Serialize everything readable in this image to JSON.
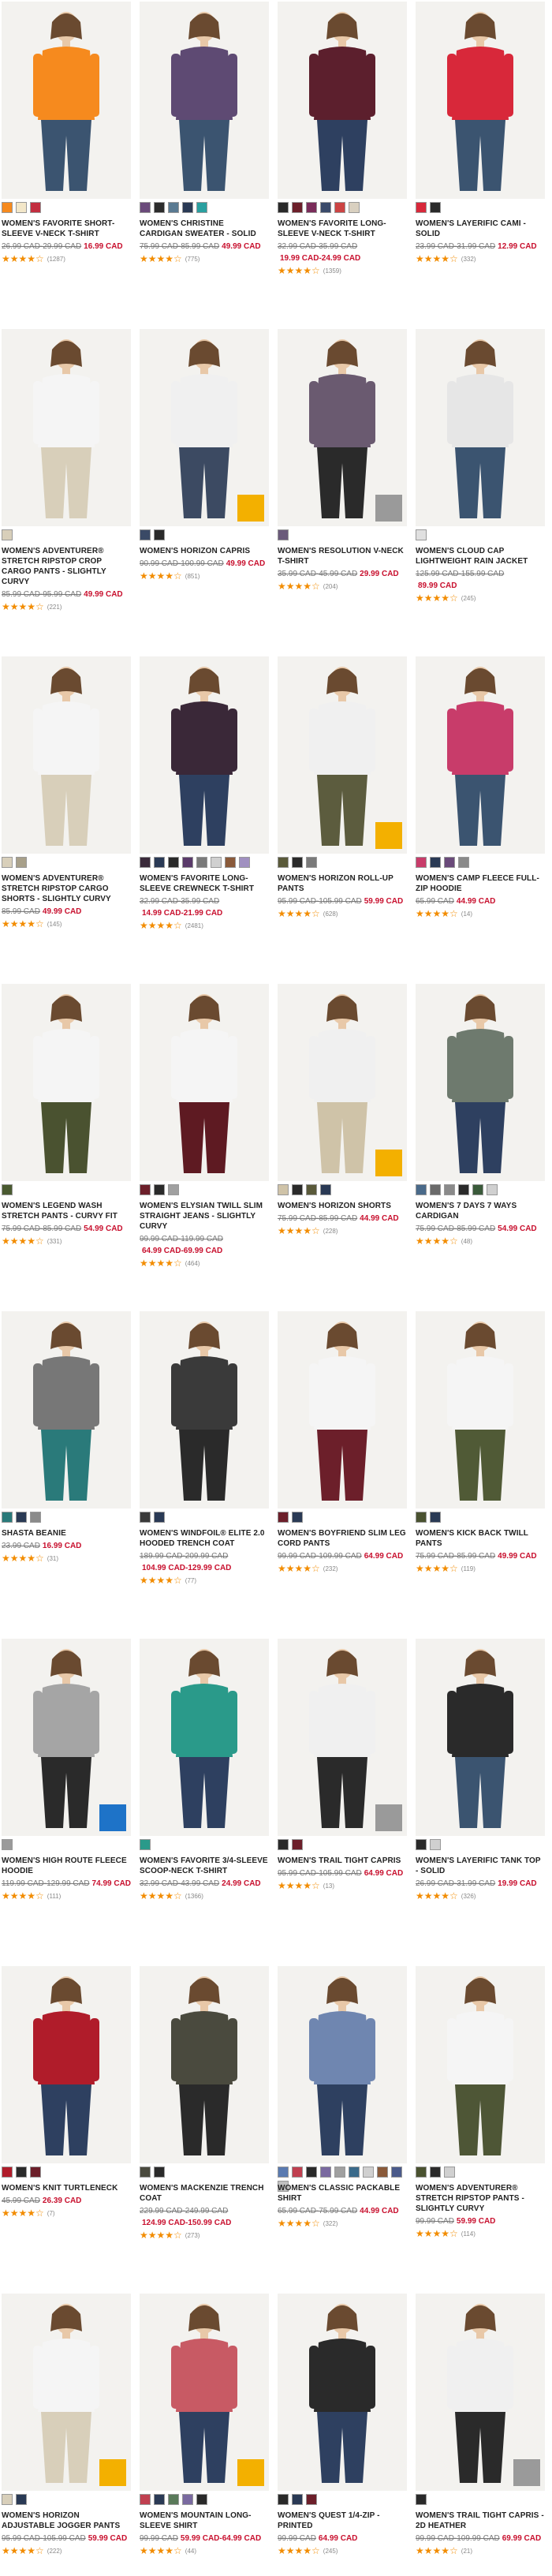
{
  "colors": {
    "sale": "#c8102e",
    "star": "#f28c00"
  },
  "products": [
    {
      "name": "WOMEN'S FAVORITE SHORT-SLEEVE V-NECK T-SHIRT",
      "was": "26.99 CAD-29.99 CAD",
      "now": "16.99 CAD",
      "rating_label": "★★★★☆",
      "rating_value": 4.5,
      "count": "(1287)",
      "swatches": [
        "#f68a1e",
        "#f3e7c9",
        "#c22e3f"
      ],
      "shirt": "#f68a1e",
      "pants": "#3b5470",
      "badge": ""
    },
    {
      "name": "WOMEN'S CHRISTINE CARDIGAN SWEATER - SOLID",
      "was": "75.99 CAD-85.99 CAD",
      "now": "49.99 CAD",
      "rating_label": "★★★★☆",
      "rating_value": 4.5,
      "count": "(775)",
      "swatches": [
        "#6a4a7a",
        "#2c2c2c",
        "#5a7a92",
        "#2a3a55",
        "#2aa0a0"
      ],
      "shirt": "#5e4a73",
      "pants": "#3b5470",
      "badge": ""
    },
    {
      "name": "WOMEN'S FAVORITE LONG-SLEEVE V-NECK T-SHIRT",
      "was": "32.99 CAD-35.99 CAD",
      "now": "19.99 CAD-24.99 CAD",
      "rating_label": "★★★★☆",
      "rating_value": 4.5,
      "count": "(1359)",
      "swatches": [
        "#2a2a2a",
        "#6c1f2a",
        "#7a2c5a",
        "#3a4a6a",
        "#cc4444",
        "#d9d0c0"
      ],
      "shirt": "#5c1f2d",
      "pants": "#2e4060",
      "badge": ""
    },
    {
      "name": "WOMEN'S LAYERIFIC CAMI - SOLID",
      "was": "23.99 CAD-31.99 CAD",
      "now": "12.99 CAD",
      "rating_label": "★★★★☆",
      "rating_value": 4.5,
      "count": "(332)",
      "swatches": [
        "#d8283a",
        "#2a2a2a"
      ],
      "shirt": "#d8283a",
      "pants": "#3b5470",
      "badge": ""
    },
    {
      "name": "WOMEN'S ADVENTURER® STRETCH RIPSTOP CROP CARGO PANTS - SLIGHTLY CURVY",
      "was": "85.99 CAD-95.99 CAD",
      "now": "49.99 CAD",
      "rating_label": "★★★★☆",
      "rating_value": 4.5,
      "count": "(221)",
      "swatches": [
        "#d8cfba"
      ],
      "shirt": "#f5f5f5",
      "pants": "#d8cfba",
      "badge": ""
    },
    {
      "name": "WOMEN'S HORIZON CAPRIS",
      "was": "90.99 CAD-100.99 CAD",
      "now": "49.99 CAD",
      "rating_label": "★★★★☆",
      "rating_value": 4.5,
      "count": "(851)",
      "swatches": [
        "#3a4a66",
        "#2a2a2a"
      ],
      "shirt": "#f0f0f0",
      "pants": "#3c4a62",
      "badge": "gold"
    },
    {
      "name": "WOMEN'S RESOLUTION V-NECK T-SHIRT",
      "was": "35.99 CAD-45.99 CAD",
      "now": "29.99 CAD",
      "rating_label": "★★★★☆",
      "rating_value": 4.5,
      "count": "(204)",
      "swatches": [
        "#6a5a7a"
      ],
      "shirt": "#6a5a70",
      "pants": "#2a2a2a",
      "badge": "grey"
    },
    {
      "name": "WOMEN'S CLOUD CAP LIGHTWEIGHT RAIN JACKET",
      "was": "125.99 CAD-155.99 CAD",
      "now": "89.99 CAD",
      "rating_label": "★★★★☆",
      "rating_value": 4.5,
      "count": "(245)",
      "swatches": [
        "#e0e0e0"
      ],
      "shirt": "#e6e6e6",
      "pants": "#3b5470",
      "badge": ""
    },
    {
      "name": "WOMEN'S ADVENTURER® STRETCH RIPSTOP CARGO SHORTS - SLIGHTLY CURVY",
      "was": "85.99 CAD",
      "now": "49.99 CAD",
      "rating_label": "★★★★☆",
      "rating_value": 4.5,
      "count": "(145)",
      "swatches": [
        "#d8cfba",
        "#a8a08a"
      ],
      "shirt": "#f5f5f5",
      "pants": "#d8cfba",
      "badge": ""
    },
    {
      "name": "WOMEN'S FAVORITE LONG-SLEEVE CREWNECK T-SHIRT",
      "was": "32.99 CAD-35.99 CAD",
      "now": "14.99 CAD-21.99 CAD",
      "rating_label": "★★★★☆",
      "rating_value": 4.5,
      "count": "(2481)",
      "swatches": [
        "#3a2a3a",
        "#2a3a55",
        "#2a2a2a",
        "#5a3a6a",
        "#7a7a7a",
        "#d0d0d0",
        "#8a5a3a",
        "#a090c0"
      ],
      "shirt": "#3a2838",
      "pants": "#2e4060",
      "badge": ""
    },
    {
      "name": "WOMEN'S HORIZON ROLL-UP PANTS",
      "was": "95.99 CAD-105.99 CAD",
      "now": "59.99 CAD",
      "rating_label": "★★★★☆",
      "rating_value": 4.5,
      "count": "(628)",
      "swatches": [
        "#5a5a3a",
        "#2a2a2a",
        "#7a7a7a"
      ],
      "shirt": "#f0f0f0",
      "pants": "#5c5c3e",
      "badge": "gold"
    },
    {
      "name": "WOMEN'S CAMP FLEECE FULL-ZIP HOODIE",
      "was": "65.99 CAD",
      "now": "44.99 CAD",
      "rating_label": "★★★★☆",
      "rating_value": 4.5,
      "count": "(14)",
      "swatches": [
        "#c83c6a",
        "#2a3a55",
        "#6a4a7a",
        "#8a8a8a"
      ],
      "shirt": "#c83c6a",
      "pants": "#3b5470",
      "badge": ""
    },
    {
      "name": "WOMEN'S LEGEND WASH STRETCH PANTS - CURVY FIT",
      "was": "75.99 CAD-85.99 CAD",
      "now": "54.99 CAD",
      "rating_label": "★★★★☆",
      "rating_value": 4.5,
      "count": "(331)",
      "swatches": [
        "#4a5a30"
      ],
      "shirt": "#f5f5f5",
      "pants": "#4a5230",
      "badge": ""
    },
    {
      "name": "WOMEN'S ELYSIAN TWILL SLIM STRAIGHT JEANS - SLIGHTLY CURVY",
      "was": "99.99 CAD-119.99 CAD",
      "now": "64.99 CAD-69.99 CAD",
      "rating_label": "★★★★☆",
      "rating_value": 4.5,
      "count": "(464)",
      "swatches": [
        "#6c1f2a",
        "#2a2a2a",
        "#a0a0a0"
      ],
      "shirt": "#f5f5f5",
      "pants": "#5e1a22",
      "badge": ""
    },
    {
      "name": "WOMEN'S HORIZON SHORTS",
      "was": "75.99 CAD-85.99 CAD",
      "now": "44.99 CAD",
      "rating_label": "★★★★☆",
      "rating_value": 4.5,
      "count": "(228)",
      "swatches": [
        "#cfc3a8",
        "#2a2a2a",
        "#5a5a3a",
        "#2a3a55"
      ],
      "shirt": "#f0f0f0",
      "pants": "#cfc3a8",
      "badge": "gold"
    },
    {
      "name": "WOMEN'S 7 DAYS 7 WAYS CARDIGAN",
      "was": "75.99 CAD-85.99 CAD",
      "now": "54.99 CAD",
      "rating_label": "★★★★☆",
      "rating_value": 4.5,
      "count": "(48)",
      "swatches": [
        "#4a6a8a",
        "#6a6a6a",
        "#8a8a8a",
        "#2a2a2a",
        "#3a5a3a",
        "#d0d0d0"
      ],
      "shirt": "#6e7a6e",
      "pants": "#2e4060",
      "badge": ""
    },
    {
      "name": "SHASTA BEANIE",
      "was": "23.99 CAD",
      "now": "16.99 CAD",
      "rating_label": "★★★★☆",
      "rating_value": 4.5,
      "count": "(31)",
      "swatches": [
        "#2a7a7a",
        "#2a3a55",
        "#8a8a8a"
      ],
      "shirt": "#777777",
      "pants": "#2a7a7a",
      "badge": ""
    },
    {
      "name": "WOMEN'S WINDFOIL® ELITE 2.0 HOODED TRENCH COAT",
      "was": "189.99 CAD-209.99 CAD",
      "now": "104.99 CAD-129.99 CAD",
      "rating_label": "★★★★☆",
      "rating_value": 4.5,
      "count": "(77)",
      "swatches": [
        "#3a3a3a",
        "#2a3a55"
      ],
      "shirt": "#3a3a3a",
      "pants": "#2a2a2a",
      "badge": ""
    },
    {
      "name": "WOMEN'S BOYFRIEND SLIM LEG CORD PANTS",
      "was": "99.99 CAD-109.99 CAD",
      "now": "64.99 CAD",
      "rating_label": "★★★★☆",
      "rating_value": 4.5,
      "count": "(232)",
      "swatches": [
        "#6c1f2a",
        "#2a3a55"
      ],
      "shirt": "#f5f5f5",
      "pants": "#6c1f2a",
      "badge": ""
    },
    {
      "name": "WOMEN'S KICK BACK TWILL PANTS",
      "was": "75.99 CAD-85.99 CAD",
      "now": "49.99 CAD",
      "rating_label": "★★★★☆",
      "rating_value": 4.5,
      "count": "(119)",
      "swatches": [
        "#4a5230",
        "#2a3a55"
      ],
      "shirt": "#f5f5f5",
      "pants": "#505a36",
      "badge": ""
    },
    {
      "name": "WOMEN'S HIGH ROUTE FLEECE HOODIE",
      "was": "119.99 CAD-129.99 CAD",
      "now": "74.99 CAD",
      "rating_label": "★★★★☆",
      "rating_value": 4.5,
      "count": "(111)",
      "swatches": [
        "#9a9a9a"
      ],
      "shirt": "#a5a5a5",
      "pants": "#2a2a2a",
      "badge": "blue"
    },
    {
      "name": "WOMEN'S FAVORITE 3/4-SLEEVE SCOOP-NECK T-SHIRT",
      "was": "32.99 CAD-43.99 CAD",
      "now": "24.99 CAD",
      "rating_label": "★★★★☆",
      "rating_value": 4.5,
      "count": "(1366)",
      "swatches": [
        "#2a9a8a"
      ],
      "shirt": "#2a9a8a",
      "pants": "#2e4060",
      "badge": ""
    },
    {
      "name": "WOMEN'S TRAIL TIGHT CAPRIS",
      "was": "95.99 CAD-105.99 CAD",
      "now": "64.99 CAD",
      "rating_label": "★★★★☆",
      "rating_value": 4.5,
      "count": "(13)",
      "swatches": [
        "#2a2a2a",
        "#6c1f2a"
      ],
      "shirt": "#f0f0f0",
      "pants": "#2a2a2a",
      "badge": "grey"
    },
    {
      "name": "WOMEN'S LAYERIFIC TANK TOP - SOLID",
      "was": "26.99 CAD-31.99 CAD",
      "now": "19.99 CAD",
      "rating_label": "★★★★☆",
      "rating_value": 4.5,
      "count": "(326)",
      "swatches": [
        "#2a2a2a",
        "#d0d0d0"
      ],
      "shirt": "#2a2a2a",
      "pants": "#3b5470",
      "badge": ""
    },
    {
      "name": "WOMEN'S KNIT TURTLENECK",
      "was": "45.99 CAD",
      "now": "26.39 CAD",
      "rating_label": "★★★★☆",
      "rating_value": 4.5,
      "count": "(7)",
      "swatches": [
        "#b01c2a",
        "#2a2a2a",
        "#6c1f2a"
      ],
      "shirt": "#b01c2a",
      "pants": "#2e4060",
      "badge": ""
    },
    {
      "name": "WOMEN'S MACKENZIE TRENCH COAT",
      "was": "229.99 CAD-249.99 CAD",
      "now": "124.99 CAD-150.99 CAD",
      "rating_label": "★★★★☆",
      "rating_value": 4.5,
      "count": "(273)",
      "swatches": [
        "#4a4a3e",
        "#2a2a2a"
      ],
      "shirt": "#4a4a3e",
      "pants": "#2a2a2a",
      "badge": ""
    },
    {
      "name": "WOMEN'S CLASSIC PACKABLE SHIRT",
      "was": "65.99 CAD-75.99 CAD",
      "now": "44.99 CAD",
      "rating_label": "★★★★☆",
      "rating_value": 4.5,
      "count": "(322)",
      "swatches": [
        "#5a7ab0",
        "#c04050",
        "#2a2a2a",
        "#7a6aa0",
        "#a0a0a0",
        "#3a6a8a",
        "#d0d0d0",
        "#8a5a3a",
        "#4a5a8a",
        "#c0c0c0"
      ],
      "shirt": "#6f86b0",
      "pants": "#2e4060",
      "badge": ""
    },
    {
      "name": "WOMEN'S ADVENTURER® STRETCH RIPSTOP PANTS - SLIGHTLY CURVY",
      "was": "99.99 CAD",
      "now": "59.99 CAD",
      "rating_label": "★★★★☆",
      "rating_value": 4.5,
      "count": "(114)",
      "swatches": [
        "#4a5230",
        "#2a2a2a",
        "#d0d0d0"
      ],
      "shirt": "#f5f5f5",
      "pants": "#4e5636",
      "badge": ""
    },
    {
      "name": "WOMEN'S HORIZON ADJUSTABLE JOGGER PANTS",
      "was": "95.99 CAD-105.99 CAD",
      "now": "59.99 CAD",
      "rating_label": "★★★★☆",
      "rating_value": 4.5,
      "count": "(222)",
      "swatches": [
        "#d8cfba",
        "#2a3a55"
      ],
      "shirt": "#f5f5f5",
      "pants": "#d8cfba",
      "badge": "gold"
    },
    {
      "name": "WOMEN'S MOUNTAIN LONG-SLEEVE SHIRT",
      "was": "99.99 CAD",
      "now": "59.99 CAD-64.99 CAD",
      "rating_label": "★★★★☆",
      "rating_value": 4.5,
      "count": "(44)",
      "swatches": [
        "#c04050",
        "#2a3a55",
        "#5a7a5a",
        "#7a6aa0",
        "#2a2a2a"
      ],
      "shirt": "#c85a64",
      "pants": "#2e4060",
      "badge": "gold"
    },
    {
      "name": "WOMEN'S QUEST 1/4-ZIP - PRINTED",
      "was": "99.99 CAD",
      "now": "64.99 CAD",
      "rating_label": "★★★★☆",
      "rating_value": 4.5,
      "count": "(245)",
      "swatches": [
        "#2a2a2a",
        "#2a3a55",
        "#6c1f2a"
      ],
      "shirt": "#2a2a2a",
      "pants": "#2e4060",
      "badge": ""
    },
    {
      "name": "WOMEN'S TRAIL TIGHT CAPRIS - 2D HEATHER",
      "was": "99.99 CAD-109.99 CAD",
      "now": "69.99 CAD",
      "rating_label": "★★★★☆",
      "rating_value": 4.5,
      "count": "(21)",
      "swatches": [
        "#2a2a2a"
      ],
      "shirt": "#f0f0f0",
      "pants": "#2a2a2a",
      "badge": "grey"
    }
  ]
}
